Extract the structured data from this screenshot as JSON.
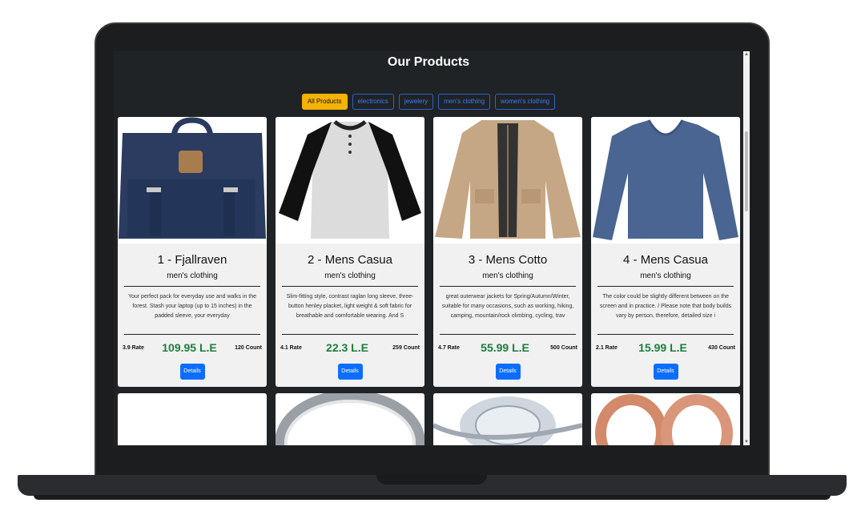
{
  "page": {
    "title": "Our Products"
  },
  "filters": [
    {
      "label": "All Products",
      "active": true
    },
    {
      "label": "electronics",
      "active": false
    },
    {
      "label": "jewelery",
      "active": false
    },
    {
      "label": "men's clothing",
      "active": false
    },
    {
      "label": "women's clothing",
      "active": false
    }
  ],
  "products": [
    {
      "title": "1 - Fjallraven",
      "category": "men's clothing",
      "description": "Your perfect pack for everyday use and walks in the forest. Stash your laptop (up to 15 inches) in the padded sleeve, your everyday",
      "rate": "3.9 Rate",
      "price": "109.95 L.E",
      "count": "120 Count",
      "button": "Details",
      "image": "backpack"
    },
    {
      "title": "2 - Mens Casua",
      "category": "men's clothing",
      "description": "Slim-fitting style, contrast raglan long sleeve, three-button henley placket, light weight & soft fabric for breathable and comfortable wearing. And S",
      "rate": "4.1 Rate",
      "price": "22.3 L.E",
      "count": "259 Count",
      "button": "Details",
      "image": "raglan-tshirt"
    },
    {
      "title": "3 - Mens Cotto",
      "category": "men's clothing",
      "description": "great outerwear jackets for Spring/Autumn/Winter, suitable for many occasions, such as working, hiking, camping, mountain/rock climbing, cycling, trav",
      "rate": "4.7 Rate",
      "price": "55.99 L.E",
      "count": "500 Count",
      "button": "Details",
      "image": "cotton-jacket"
    },
    {
      "title": "4 - Mens Casua",
      "category": "men's clothing",
      "description": "The color could be slightly different between on the screen and in practice. / Please note that body builds vary by person, therefore, detailed size i",
      "rate": "2.1 Rate",
      "price": "15.99 L.E",
      "count": "430 Count",
      "button": "Details",
      "image": "blue-longsleeve"
    }
  ],
  "next_row": [
    {
      "image": "blank"
    },
    {
      "image": "silver-ring"
    },
    {
      "image": "diamond-ring"
    },
    {
      "image": "rose-gold-rings"
    }
  ],
  "colors": {
    "accent": "#f5b301",
    "primary": "#0d6efd",
    "price": "#1a7f3c",
    "background": "#202326"
  }
}
